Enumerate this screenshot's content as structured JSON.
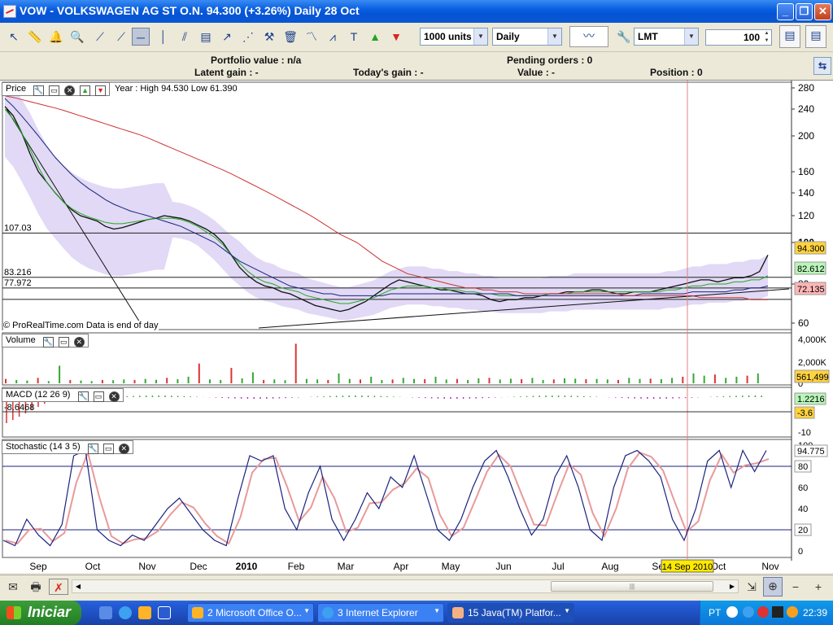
{
  "window": {
    "title": "VOW - VOLKSWAGEN AG ST O.N.     94.300  (+3.26%)     Daily   28 Oct",
    "minimize": "_",
    "maximize": "❐",
    "close": "✕"
  },
  "toolbar": {
    "units_select": "1000 units",
    "period_select": "Daily",
    "order_type_select": "LMT",
    "quantity_value": "100"
  },
  "info": {
    "portfolio_value": "Portfolio value : n/a",
    "latent_gain": "Latent gain : -",
    "todays_gain": "Today's gain : -",
    "pending_orders": "Pending orders : 0",
    "value": "Value : -",
    "position": "Position : 0"
  },
  "price_panel": {
    "label": "Price",
    "year_info": "Year : High 94.530 Low 61.390",
    "copyright": "© ProRealTime.com  Data is end of day",
    "level_labels": [
      "107.03",
      "83.216",
      "77.972"
    ],
    "right_badges": [
      {
        "text": "94.300",
        "color": "#ffd23f"
      },
      {
        "text": "82.612",
        "color": "#b9f5b9"
      },
      {
        "text": "72.135",
        "color": "#ffb6b6"
      }
    ]
  },
  "volume_panel": {
    "label": "Volume",
    "badge": "561,499"
  },
  "macd_panel": {
    "label": "MACD (12 26 9)",
    "value_label": "-8.6468",
    "badges": [
      "1.2216",
      "-3.6"
    ]
  },
  "stoch_panel": {
    "label": "Stochastic (14 3 5)",
    "badge": "94.775"
  },
  "cursor_date": "14 Sep 2010",
  "chart_data": {
    "type": "line",
    "title": "",
    "price_axis_ticks": [
      60,
      80,
      100,
      120,
      140,
      160,
      200,
      240,
      280
    ],
    "volume_axis_ticks": [
      "4,000K",
      "2,000K",
      "0"
    ],
    "macd_axis_ticks": [
      "0",
      "-10"
    ],
    "stoch_axis_ticks": [
      0,
      20,
      40,
      60,
      80,
      100
    ],
    "x_labels": [
      "Sep",
      "Oct",
      "Nov",
      "Dec",
      "2010",
      "Feb",
      "Mar",
      "Apr",
      "May",
      "Jun",
      "Jul",
      "Aug",
      "Sep",
      "Oct",
      "Nov"
    ],
    "horizontal_levels": [
      107.03,
      83.216,
      77.972,
      72.135
    ],
    "ylim": [
      55,
      285
    ],
    "series": [
      {
        "color": "#111111",
        "values": [
          245,
          230,
          205,
          180,
          160,
          150,
          140,
          132,
          125,
          120,
          118,
          116,
          112,
          110,
          111,
          113,
          115,
          117,
          118,
          120,
          119,
          118,
          116,
          113,
          110,
          106,
          100,
          94,
          88,
          84,
          81,
          79,
          78,
          76,
          75,
          73,
          71,
          69,
          68,
          67,
          66,
          67,
          69,
          71,
          74,
          77,
          80,
          82,
          81,
          80,
          79,
          78,
          77,
          77,
          76,
          75,
          75,
          74,
          72,
          71,
          72,
          72,
          73,
          73,
          74,
          75,
          75,
          76,
          76,
          76,
          77,
          77,
          76,
          75,
          75,
          76,
          76,
          76,
          77,
          78,
          79,
          80,
          81,
          82,
          82,
          81,
          82,
          83,
          83,
          84,
          86,
          94
        ]
      },
      {
        "color": "#22aa22",
        "values": [
          240,
          225,
          205,
          185,
          165,
          150,
          140,
          132,
          126,
          122,
          119,
          117,
          115,
          114,
          114,
          115,
          116,
          117,
          118,
          118,
          118,
          117,
          115,
          112,
          108,
          104,
          99,
          94,
          90,
          86,
          83,
          81,
          80,
          78,
          77,
          76,
          74,
          73,
          72,
          71,
          70,
          70,
          71,
          72,
          73,
          75,
          77,
          78,
          79,
          79,
          79,
          78,
          78,
          77,
          77,
          76,
          76,
          75,
          75,
          74,
          74,
          74,
          74,
          74,
          74,
          75,
          75,
          75,
          76,
          76,
          76,
          76,
          76,
          76,
          76,
          76,
          76,
          76,
          76,
          77,
          77,
          78,
          79,
          79,
          80,
          80,
          80,
          81,
          81,
          82,
          82,
          84
        ]
      },
      {
        "color": "#1a237e",
        "values": [
          260,
          245,
          230,
          215,
          200,
          188,
          176,
          166,
          157,
          150,
          144,
          139,
          134,
          130,
          127,
          124,
          122,
          120,
          118,
          116,
          114,
          112,
          109,
          106,
          103,
          100,
          97,
          94,
          91,
          89,
          87,
          85,
          83,
          81,
          79,
          78,
          77,
          76,
          75,
          75,
          74,
          74,
          74,
          74,
          74,
          74,
          75,
          75,
          75,
          75,
          75,
          75,
          75,
          75,
          75,
          75,
          75,
          75,
          75,
          75,
          75,
          74,
          74,
          74,
          74,
          74,
          74,
          74,
          74,
          74,
          74,
          74,
          74,
          74,
          74,
          74,
          75,
          75,
          75,
          75,
          75,
          75,
          76,
          76,
          76,
          76,
          76,
          77,
          77,
          78,
          78,
          79
        ]
      },
      {
        "color": "#cc3333",
        "values": [
          265,
          262,
          258,
          254,
          250,
          246,
          242,
          238,
          234,
          230,
          226,
          222,
          218,
          214,
          210,
          206,
          202,
          198,
          194,
          190,
          186,
          182,
          178,
          174,
          170,
          166,
          162,
          158,
          154,
          150,
          146,
          142,
          138,
          134,
          130,
          126,
          122,
          118,
          114,
          110,
          106,
          103,
          100,
          97,
          94,
          91,
          89,
          87,
          85,
          84,
          83,
          82,
          81,
          80,
          79,
          78,
          78,
          77,
          77,
          76,
          76,
          76,
          75,
          75,
          75,
          75,
          75,
          75,
          75,
          75,
          75,
          75,
          75,
          75,
          74,
          74,
          74,
          74,
          74,
          74,
          74,
          74,
          74,
          73,
          73,
          73,
          73,
          73,
          73,
          72,
          72,
          72
        ]
      }
    ],
    "stochastic": [
      10,
      5,
      30,
      15,
      5,
      25,
      90,
      95,
      20,
      10,
      5,
      15,
      10,
      25,
      40,
      50,
      35,
      20,
      10,
      5,
      50,
      90,
      85,
      90,
      40,
      20,
      55,
      80,
      30,
      10,
      30,
      55,
      40,
      70,
      60,
      90,
      55,
      20,
      10,
      30,
      60,
      85,
      95,
      70,
      40,
      15,
      30,
      70,
      90,
      60,
      20,
      10,
      60,
      90,
      95,
      85,
      70,
      30,
      10,
      40,
      85,
      95,
      60,
      95,
      75,
      95
    ],
    "volume": [
      400,
      300,
      250,
      500,
      200,
      1600,
      300,
      250,
      200,
      300,
      280,
      350,
      300,
      400,
      320,
      500,
      380,
      600,
      1800,
      350,
      300,
      1400,
      450,
      1000,
      300,
      350,
      280,
      3600,
      400,
      350,
      300,
      900,
      400,
      350,
      600,
      300,
      350,
      500,
      400,
      380,
      600,
      350,
      400,
      300,
      450,
      500,
      350,
      420,
      380,
      500,
      300,
      350,
      450,
      420,
      380,
      400,
      350,
      300,
      500,
      400,
      420,
      380,
      500,
      600,
      900,
      700,
      800,
      500,
      600,
      700,
      900
    ]
  },
  "status": {
    "zoom_in": "+",
    "zoom_out": "−"
  },
  "taskbar": {
    "start": "Iniciar",
    "tasks": [
      "2 Microsoft Office O...",
      "3 Internet Explorer",
      "15 Java(TM) Platfor..."
    ],
    "language": "PT",
    "clock": "22:39"
  }
}
